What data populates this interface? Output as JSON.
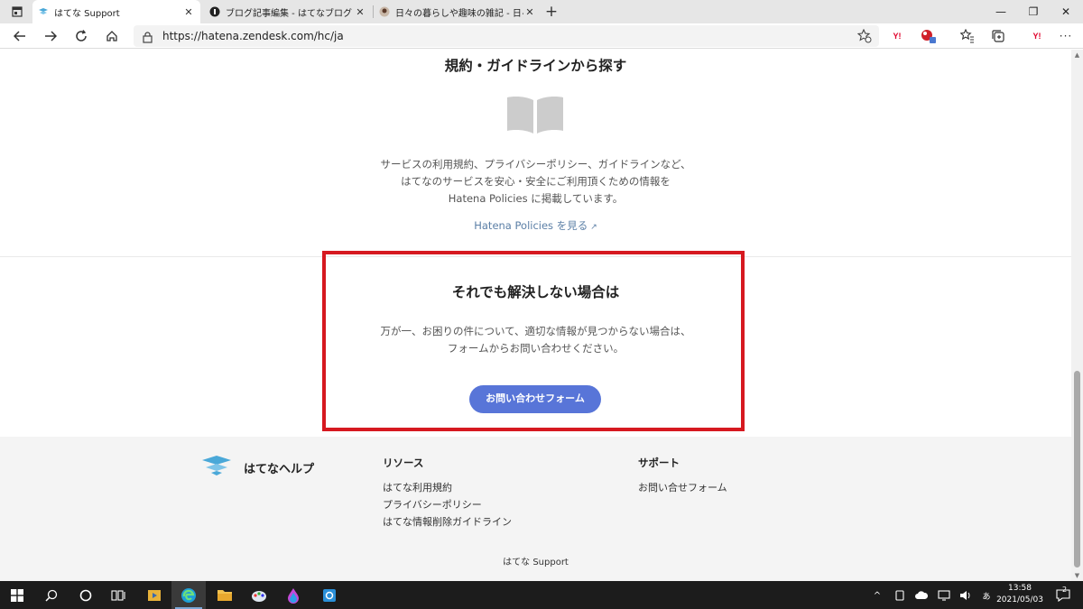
{
  "browser": {
    "tabs": [
      {
        "title": "はてな Support",
        "active": true
      },
      {
        "title": "ブログ記事編集 - はてなブログ",
        "active": false
      },
      {
        "title": "日々の暮らしや趣味の雑記 - 日々の",
        "active": false
      }
    ],
    "url": "https://hatena.zendesk.com/hc/ja",
    "accent": "#5875d8"
  },
  "policies": {
    "title": "規約・ガイドラインから探す",
    "desc_line1": "サービスの利用規約、プライバシーポリシー、ガイドラインなど、",
    "desc_line2": "はてなのサービスを安心・安全にご利用頂くための情報を",
    "desc_line3": "Hatena Policies に掲載しています。",
    "link": "Hatena Policies を見る",
    "icon": "book-icon"
  },
  "contact": {
    "title": "それでも解決しない場合は",
    "desc_line1": "万が一、お困りの件について、適切な情報が見つからない場合は、",
    "desc_line2": "フォームからお問い合わせください。",
    "button": "お問い合わせフォーム",
    "highlight_color": "#d61920"
  },
  "footer": {
    "brand": "はてなヘルプ",
    "resources_heading": "リソース",
    "resources": [
      "はてな利用規約",
      "プライバシーポリシー",
      "はてな情報削除ガイドライン"
    ],
    "support_heading": "サポート",
    "support_links": [
      "お問い合せフォーム"
    ],
    "copyright": "はてな Support"
  },
  "taskbar": {
    "time": "13:58",
    "date": "2021/05/03",
    "notification_count": "2"
  }
}
